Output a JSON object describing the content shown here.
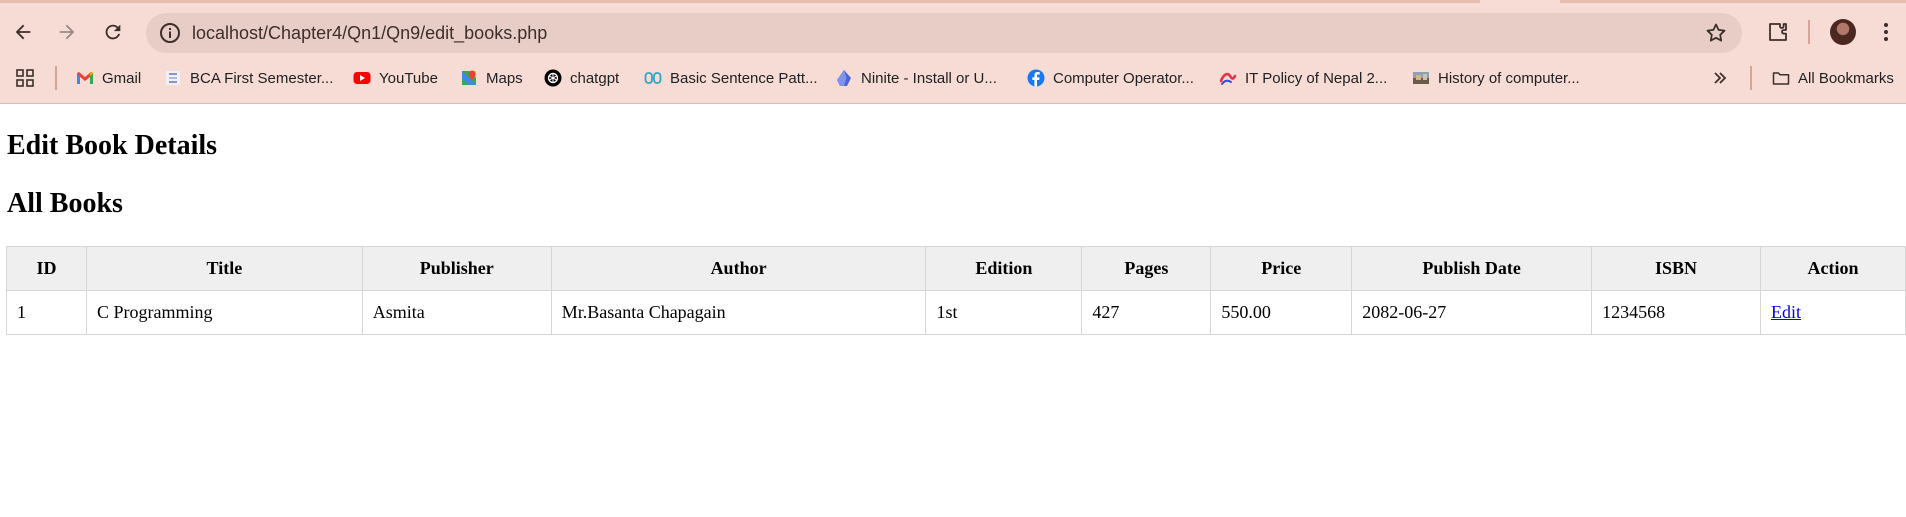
{
  "browser": {
    "url": "localhost/Chapter4/Qn1/Qn9/edit_books.php",
    "bookmarks": [
      {
        "label": "Gmail",
        "icon": "gmail-icon"
      },
      {
        "label": "BCA First Semester...",
        "icon": "bca-site-icon"
      },
      {
        "label": "YouTube",
        "icon": "youtube-icon"
      },
      {
        "label": "Maps",
        "icon": "maps-icon"
      },
      {
        "label": "chatgpt",
        "icon": "chatgpt-icon"
      },
      {
        "label": "Basic Sentence Patt...",
        "icon": "sentence-site-icon"
      },
      {
        "label": "Ninite - Install or U...",
        "icon": "ninite-icon"
      },
      {
        "label": "Computer Operator...",
        "icon": "facebook-icon"
      },
      {
        "label": "IT Policy of Nepal 2...",
        "icon": "it-policy-icon"
      },
      {
        "label": "History of computer...",
        "icon": "history-thumbnail-icon"
      }
    ],
    "all_bookmarks_label": "All Bookmarks"
  },
  "page": {
    "heading": "Edit Book Details",
    "subheading": "All Books"
  },
  "table": {
    "headers": [
      "ID",
      "Title",
      "Publisher",
      "Author",
      "Edition",
      "Pages",
      "Price",
      "Publish Date",
      "ISBN",
      "Action"
    ],
    "rows": [
      {
        "id": "1",
        "title": "C Programming",
        "publisher": "Asmita",
        "author": "Mr.Basanta Chapagain",
        "edition": "1st",
        "pages": "427",
        "price": "550.00",
        "publish_date": "2082-06-27",
        "isbn": "1234568",
        "action": "Edit"
      }
    ]
  },
  "colors": {
    "chrome_bg": "#f7dcd5",
    "omnibox_bg": "#e8cdc6",
    "link": "#0000ee",
    "table_header_bg": "#efefef"
  }
}
